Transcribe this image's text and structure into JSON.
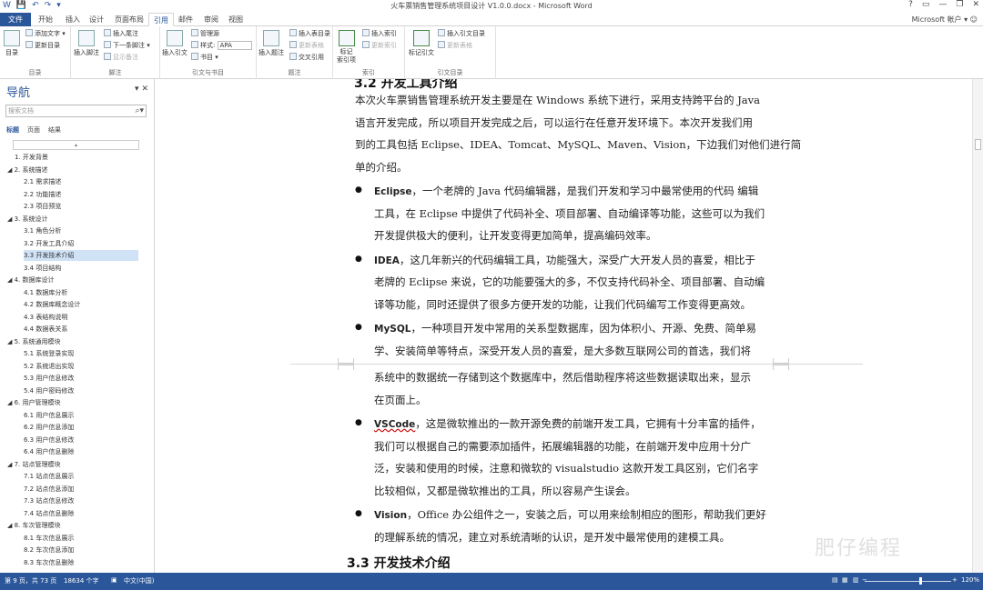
{
  "window": {
    "title": "火车票销售管理系统项目设计 V1.0.0.docx - Microsoft Word",
    "account": "Microsoft 帐户",
    "help": "?",
    "controls": [
      "?",
      "▭",
      "—",
      "❐",
      "✕"
    ]
  },
  "quick_access": [
    "W",
    "💾",
    "↶",
    "↷",
    "▾"
  ],
  "tabs": {
    "file": "文件",
    "items": [
      "开始",
      "插入",
      "设计",
      "页面布局",
      "引用",
      "邮件",
      "审阅",
      "视图"
    ],
    "active": "引用"
  },
  "ribbon": {
    "toc": {
      "big": "目录",
      "add_text": "添加文字",
      "update_toc": "更新目录",
      "label": "目录"
    },
    "footnotes": {
      "big": "插入脚注",
      "insert_endnote": "插入尾注",
      "next_footnote": "下一条脚注",
      "show_notes": "显示备注",
      "label": "脚注"
    },
    "citations": {
      "big": "插入引文",
      "manage_sources": "管理源",
      "style_label": "样式:",
      "style_value": "APA",
      "bibliography": "书目",
      "label": "引文与书目"
    },
    "captions": {
      "big": "插入题注",
      "insert_tof": "插入表目录",
      "update_table": "更新表格",
      "cross_ref": "交叉引用",
      "label": "题注"
    },
    "index": {
      "big": "标记\n索引项",
      "insert_index": "插入索引",
      "update_index": "更新索引",
      "label": "索引"
    },
    "toa": {
      "big": "标记引文",
      "insert_toa": "插入引文目录",
      "update_table": "更新表格",
      "label": "引文目录"
    }
  },
  "nav": {
    "title": "导航",
    "search_placeholder": "搜索文档",
    "tabs": [
      "标题",
      "页面",
      "结果"
    ],
    "active_tab": "标题",
    "items": [
      {
        "text": "1. 开发背景",
        "level": 1
      },
      {
        "text": "◢ 2. 系统描述",
        "level": 0
      },
      {
        "text": "2.1 需求描述",
        "level": 2
      },
      {
        "text": "2.2 功能描述",
        "level": 2
      },
      {
        "text": "2.3 项目预览",
        "level": 2
      },
      {
        "text": "◢ 3. 系统设计",
        "level": 0
      },
      {
        "text": "3.1 角色分析",
        "level": 2
      },
      {
        "text": "3.2 开发工具介绍",
        "level": 2
      },
      {
        "text": "3.3 开发技术介绍",
        "level": 2,
        "selected": true
      },
      {
        "text": "3.4 项目结构",
        "level": 2
      },
      {
        "text": "◢ 4. 数据库设计",
        "level": 0
      },
      {
        "text": "4.1 数据库分析",
        "level": 2
      },
      {
        "text": "4.2 数据库概念设计",
        "level": 2
      },
      {
        "text": "4.3 表结构说明",
        "level": 2
      },
      {
        "text": "4.4 数据表关系",
        "level": 2
      },
      {
        "text": "◢ 5. 系统通用模块",
        "level": 0
      },
      {
        "text": "5.1 系统登录实现",
        "level": 2
      },
      {
        "text": "5.2 系统退出实现",
        "level": 2
      },
      {
        "text": "5.3 用户信息修改",
        "level": 2
      },
      {
        "text": "5.4 用户密码修改",
        "level": 2
      },
      {
        "text": "◢ 6. 用户管理模块",
        "level": 0
      },
      {
        "text": "6.1 用户信息展示",
        "level": 2
      },
      {
        "text": "6.2 用户信息添加",
        "level": 2
      },
      {
        "text": "6.3 用户信息修改",
        "level": 2
      },
      {
        "text": "6.4 用户信息删除",
        "level": 2
      },
      {
        "text": "◢ 7. 站点管理模块",
        "level": 0
      },
      {
        "text": "7.1 站点信息展示",
        "level": 2
      },
      {
        "text": "7.2 站点信息添加",
        "level": 2
      },
      {
        "text": "7.3 站点信息修改",
        "level": 2
      },
      {
        "text": "7.4 站点信息删除",
        "level": 2
      },
      {
        "text": "◢ 8. 车次管理模块",
        "level": 0
      },
      {
        "text": "8.1 车次信息展示",
        "level": 2
      },
      {
        "text": "8.2 车次信息添加",
        "level": 2
      },
      {
        "text": "8.3 车次信息删除",
        "level": 2
      }
    ]
  },
  "doc": {
    "partial_heading": "3.2 开发工具介绍",
    "intro": [
      "本次火车票销售管理系统开发主要是在 Windows 系统下进行，采用支持跨平台的 Java",
      "语言开发完成，所以项目开发完成之后，可以运行在任意开发环境下。本次开发我们用",
      "到的工具包括 Eclipse、IDEA、Tomcat、MySQL、Maven、Vision，下边我们对他们进行简",
      "单的介绍。"
    ],
    "bullets": [
      {
        "kw": "Eclipse",
        "lines": [
          "，一个老牌的 Java 代码编辑器，是我们开发和学习中最常使用的代码 编辑",
          "工具，在 Eclipse 中提供了代码补全、项目部署、自动编译等功能，这些可以为我们",
          "开发提供极大的便利，让开发变得更加简单，提高编码效率。"
        ]
      },
      {
        "kw": "IDEA",
        "lines": [
          "，这几年新兴的代码编辑工具，功能强大，深受广大开发人员的喜爱，相比于",
          "老牌的 Eclipse 来说，它的功能要强大的多，不仅支持代码补全、项目部署、自动编",
          "译等功能，同时还提供了很多方便开发的功能，让我们代码编写工作变得更高效。"
        ]
      },
      {
        "kw": "MySQL",
        "lines": [
          "，一种项目开发中常用的关系型数据库，因为体积小、开源、免费、简单易",
          "学、安装简单等特点，深受开发人员的喜爱，是大多数互联网公司的首选，我们将"
        ]
      }
    ],
    "continued": [
      "系统中的数据统一存储到这个数据库中，然后借助程序将这些数据读取出来，显示",
      "在页面上。"
    ],
    "bullets2": [
      {
        "kw": "VSCode",
        "lines": [
          "，这是微软推出的一款开源免费的前端开发工具，它拥有十分丰富的插件，",
          "我们可以根据自己的需要添加插件，拓展编辑器的功能，在前端开发中应用十分广",
          "泛，安装和使用的时候，注意和微软的 visualstudio 这款开发工具区别，它们名字",
          "比较相似，又都是微软推出的工具，所以容易产生误会。"
        ]
      },
      {
        "kw": "Vision",
        "lines": [
          "，Office 办公组件之一，安装之后，可以用来绘制相应的图形，帮助我们更好",
          "的理解系统的情况，建立对系统清晰的认识，是开发中最常使用的建模工具。"
        ]
      }
    ],
    "heading": "3.3  开发技术介绍"
  },
  "watermark": "肥仔编程",
  "status": {
    "page": "第 9 页，共 73 页",
    "words": "18634 个字",
    "lang": "中文(中国)",
    "zoom": "120%",
    "zoom_level": 1.2
  }
}
